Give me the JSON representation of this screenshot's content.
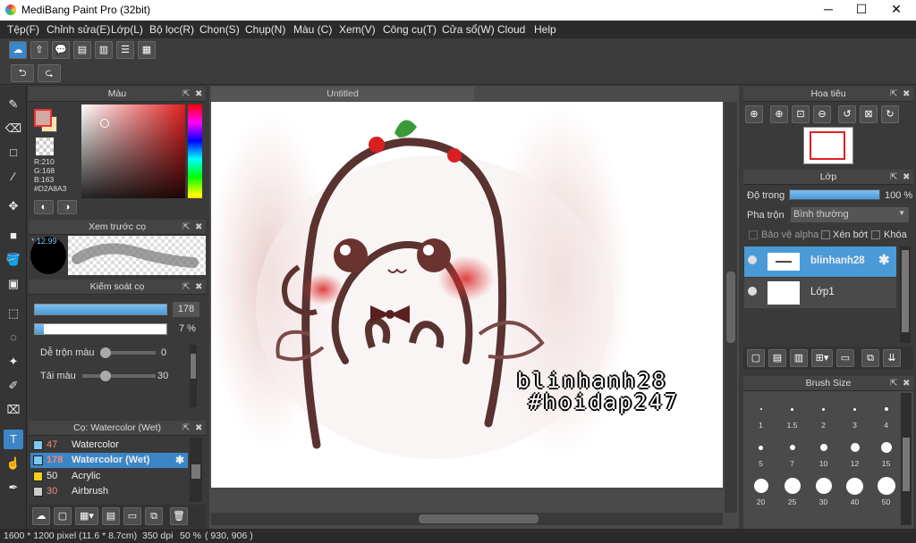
{
  "title": "MediBang Paint Pro (32bit)",
  "menu": [
    "Tệp(F)",
    "Chỉnh sửa(E)",
    "Lớp(L)",
    "Bộ lọc(R)",
    "Chọn(S)",
    "Chụp(N)",
    "Màu (C)",
    "Xem(V)",
    "Công cụ(T)",
    "Cửa sổ(W)",
    "Cloud",
    "Help"
  ],
  "color_panel": {
    "title": "Màu",
    "r": "R:210",
    "g": "G:168",
    "b": "B:163",
    "hex": "#D2A8A3",
    "main_color": "#D2A8A3"
  },
  "preview_panel": {
    "title": "Xem trước cọ",
    "size": "12.99"
  },
  "brush_ctrl": {
    "title": "Kiếm soát cọ",
    "size_val": "178",
    "size_frac": 1.0,
    "opacity_val": "7 %",
    "opacity_frac": 0.07,
    "blend_label": "Dễ trộn màu",
    "blend_val": "0",
    "amount_label": "Tải màu",
    "amount_val": "30"
  },
  "brush_list": {
    "title": "Cọ: Watercolor (Wet)",
    "items": [
      {
        "num": "47",
        "name": "Watercolor",
        "color": "#7ec8f0"
      },
      {
        "num": "178",
        "name": "Watercolor (Wet)",
        "color": "#7ec8f0"
      },
      {
        "num": "50",
        "name": "Acrylic",
        "color": "#f0d020"
      },
      {
        "num": "30",
        "name": "Airbrush",
        "color": "#cccccc"
      }
    ]
  },
  "canvas": {
    "tab": "Untitled",
    "text1": "blinhanh28",
    "text2": "#hoidap247"
  },
  "navigator": {
    "title": "Hoa tiêu"
  },
  "layers": {
    "title": "Lớp",
    "opacity_label": "Độ trong",
    "opacity_val": "100 %",
    "opacity_frac": 1.0,
    "blend_label": "Pha trộn",
    "blend_val": "Bình thường",
    "protect_alpha": "Bảo vệ alpha",
    "clip": "Xén bớt",
    "lock": "Khóa",
    "items": [
      {
        "name": "blinhanh28"
      },
      {
        "name": "Lớp1"
      }
    ]
  },
  "brush_size": {
    "title": "Brush Size",
    "rows": [
      [
        "1",
        "1.5",
        "2",
        "3",
        "4"
      ],
      [
        "5",
        "7",
        "10",
        "12",
        "15"
      ],
      [
        "20",
        "25",
        "30",
        "40",
        "50"
      ]
    ]
  },
  "status": {
    "dims": "1600 * 1200 pixel",
    "cm": "(11.6 * 8.7cm)",
    "dpi": "350 dpi",
    "zoom": "50 %",
    "coords": "( 930, 906 )"
  }
}
